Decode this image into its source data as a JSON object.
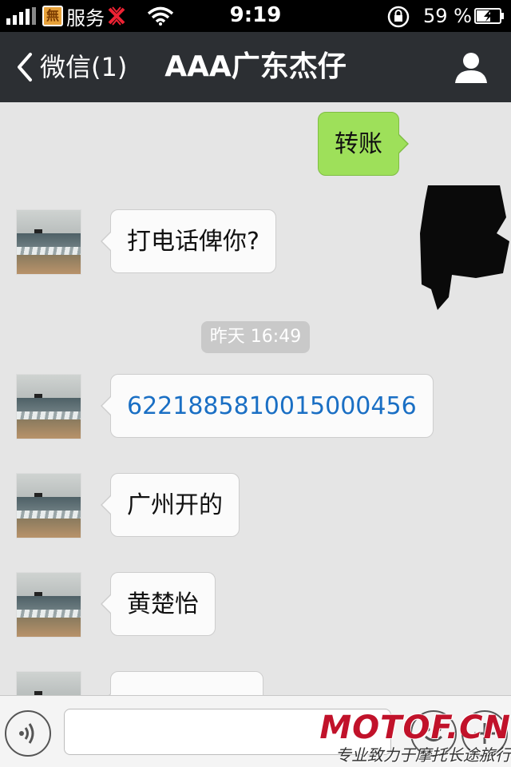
{
  "status_bar": {
    "carrier_logo_char": "無",
    "carrier": "服务",
    "time": "9:19",
    "battery_percent": "59 %"
  },
  "nav": {
    "back_label": "微信(1)",
    "title": "AAA广东杰仔"
  },
  "messages": [
    {
      "side": "self",
      "text": "转账"
    },
    {
      "side": "other",
      "text": "打电话俾你?"
    },
    {
      "side": "other",
      "text": "6221885810015000456",
      "is_link": true
    },
    {
      "side": "other",
      "text": "广州开的"
    },
    {
      "side": "other",
      "text": "黄楚怡"
    }
  ],
  "timestamp": "昨天 16:49",
  "watermark": {
    "logo": "MOTOF.CN",
    "slogan": "专业致力于摩托长途旅行"
  },
  "colors": {
    "nav_bg": "#2c2f33",
    "chat_bg": "#e5e5e5",
    "self_bubble": "#9ee05a",
    "link": "#1a6fc4"
  },
  "icons": [
    "signal-bars-icon",
    "carrier-logo-icon",
    "no-service-icon",
    "wifi-icon",
    "rotation-lock-icon",
    "battery-icon",
    "back-chevron-icon",
    "profile-icon",
    "voice-icon",
    "emoji-icon",
    "plus-icon"
  ]
}
